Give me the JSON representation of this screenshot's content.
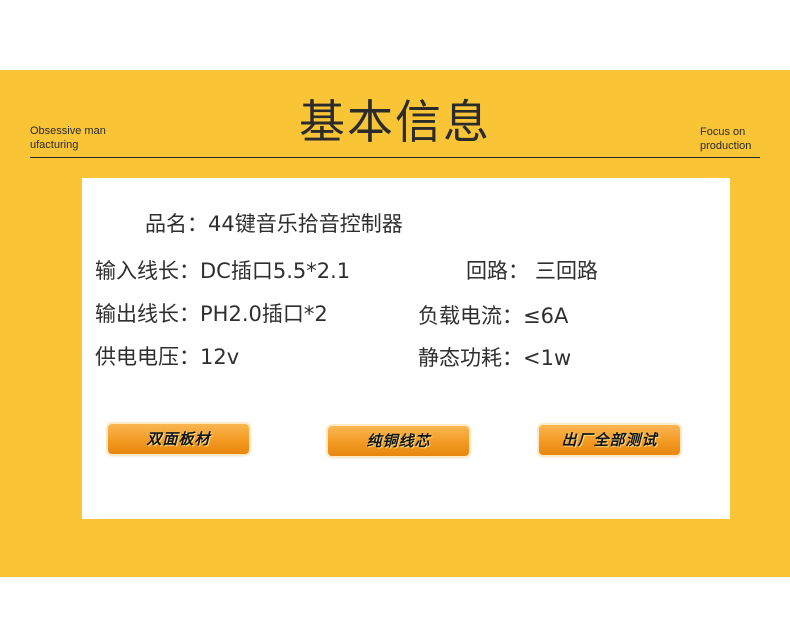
{
  "header": {
    "title": "基本信息",
    "left_tagline": "Obsessive man ufacturing",
    "right_tagline": "Focus on production"
  },
  "specs": {
    "name": {
      "label": "品名：",
      "value": "44键音乐拾音控制器"
    },
    "input_cable": {
      "label": "输入线长：",
      "value": "DC插口5.5*2.1"
    },
    "circuits": {
      "label": "回路：",
      "value": "三回路"
    },
    "output_cable": {
      "label": "输出线长：",
      "value": "PH2.0插口*2"
    },
    "load_current": {
      "label": "负载电流：",
      "value": "≤6A"
    },
    "supply_voltage": {
      "label": "供电电压：",
      "value": "12v"
    },
    "static_power": {
      "label": "静态功耗：",
      "value": "<1w"
    }
  },
  "features": [
    {
      "label": "双面板材"
    },
    {
      "label": "纯铜线芯"
    },
    {
      "label": "出厂全部测试"
    }
  ],
  "colors": {
    "band": "#f9c537",
    "button_top": "#fbb652",
    "button_bottom": "#e7860f",
    "text": "#2f2f2f"
  }
}
